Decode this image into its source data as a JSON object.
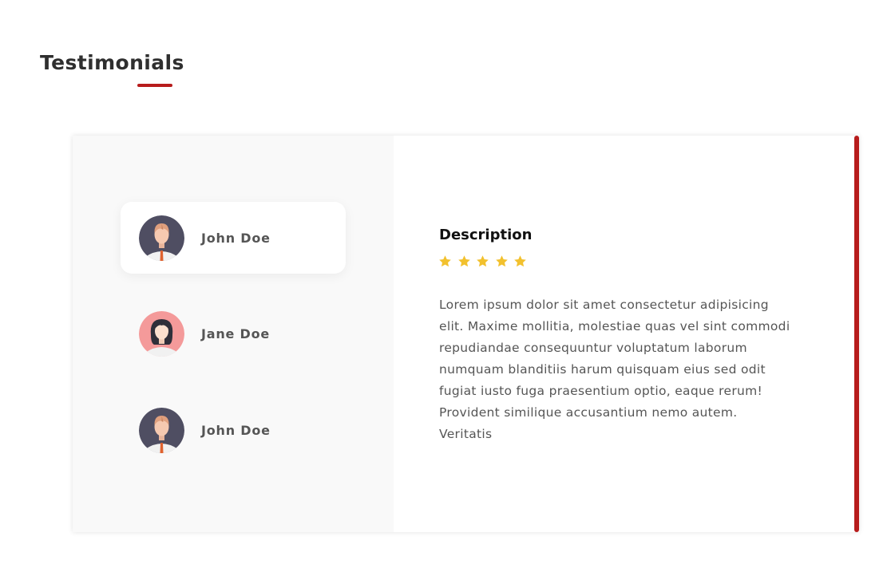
{
  "section": {
    "title": "Testimonials"
  },
  "testimonials": [
    {
      "name": "John Doe",
      "avatar": "male-avatar-icon",
      "active": true
    },
    {
      "name": "Jane Doe",
      "avatar": "female-avatar-icon",
      "active": false
    },
    {
      "name": "John Doe",
      "avatar": "male-avatar-icon",
      "active": false
    }
  ],
  "detail": {
    "title": "Description",
    "rating": 5,
    "rating_max": 5,
    "text": "Lorem ipsum dolor sit amet consectetur adipisicing elit. Maxime mollitia, molestiae quas vel sint commodi repudiandae consequuntur voluptatum laborum numquam blanditiis harum quisquam eius sed odit fugiat iusto fuga praesentium optio, eaque rerum! Provident similique accusantium nemo autem. Veritatis"
  },
  "colors": {
    "accent": "#b71c1c",
    "star": "#f2c12e",
    "panel_bg": "#f9f9f9",
    "male_avatar_bg": "#4f4e62",
    "female_avatar_bg": "#f49a9a"
  }
}
